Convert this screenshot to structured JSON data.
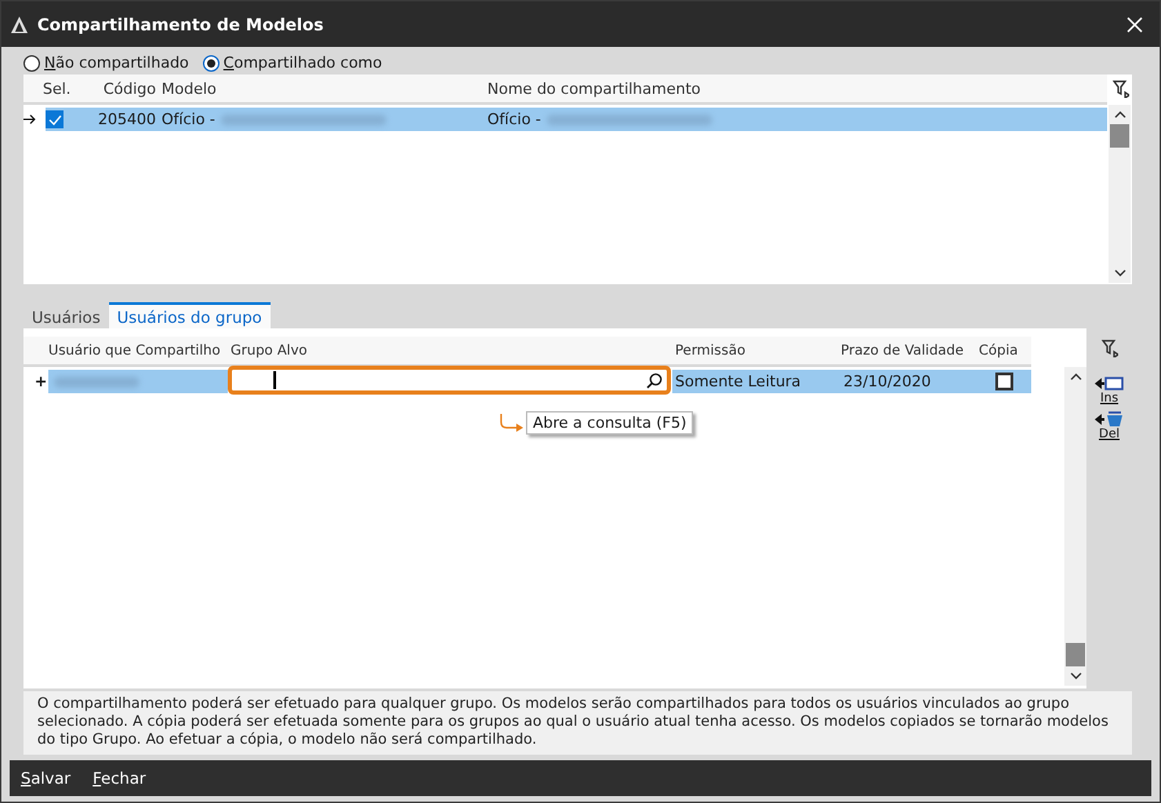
{
  "window": {
    "title": "Compartilhamento de Modelos"
  },
  "share_options": [
    {
      "label": "Não compartilhado",
      "selected": false
    },
    {
      "label": "Compartilhado como",
      "selected": true
    }
  ],
  "models_table": {
    "columns": [
      "Sel.",
      "Código",
      "Modelo",
      "Nome do compartilhamento"
    ],
    "rows": [
      {
        "selected": true,
        "checked": true,
        "code": "205400",
        "model": "Ofício -",
        "share_name": "Ofício -"
      }
    ]
  },
  "tabs": [
    {
      "label": "Usuários",
      "selected": false
    },
    {
      "label": "Usuários do grupo",
      "selected": true
    }
  ],
  "group_table": {
    "columns": [
      "Usuário que Compartilho",
      "Grupo Alvo",
      "Permissão",
      "Prazo de Validade",
      "Cópia"
    ],
    "rows": [
      {
        "marker": "+",
        "selected": true,
        "permission": "Somente Leitura",
        "validity": "23/10/2020",
        "copy": false
      }
    ]
  },
  "side_buttons": [
    {
      "label": "Ins",
      "kind": "insert"
    },
    {
      "label": "Del",
      "kind": "delete"
    }
  ],
  "tooltip": "Abre a consulta (F5)",
  "info_text": "O compartilhamento poderá ser efetuado para qualquer grupo. Os modelos serão compartilhados para todos os usuários vinculados ao grupo selecionado. A cópia poderá ser efetuada somente para os grupos ao qual o usuário atual tenha acesso. Os modelos copiados se tornarão modelos do tipo Grupo. Ao efetuar a cópia, o modelo não será compartilhado.",
  "footer_buttons": [
    "Salvar",
    "Fechar"
  ]
}
